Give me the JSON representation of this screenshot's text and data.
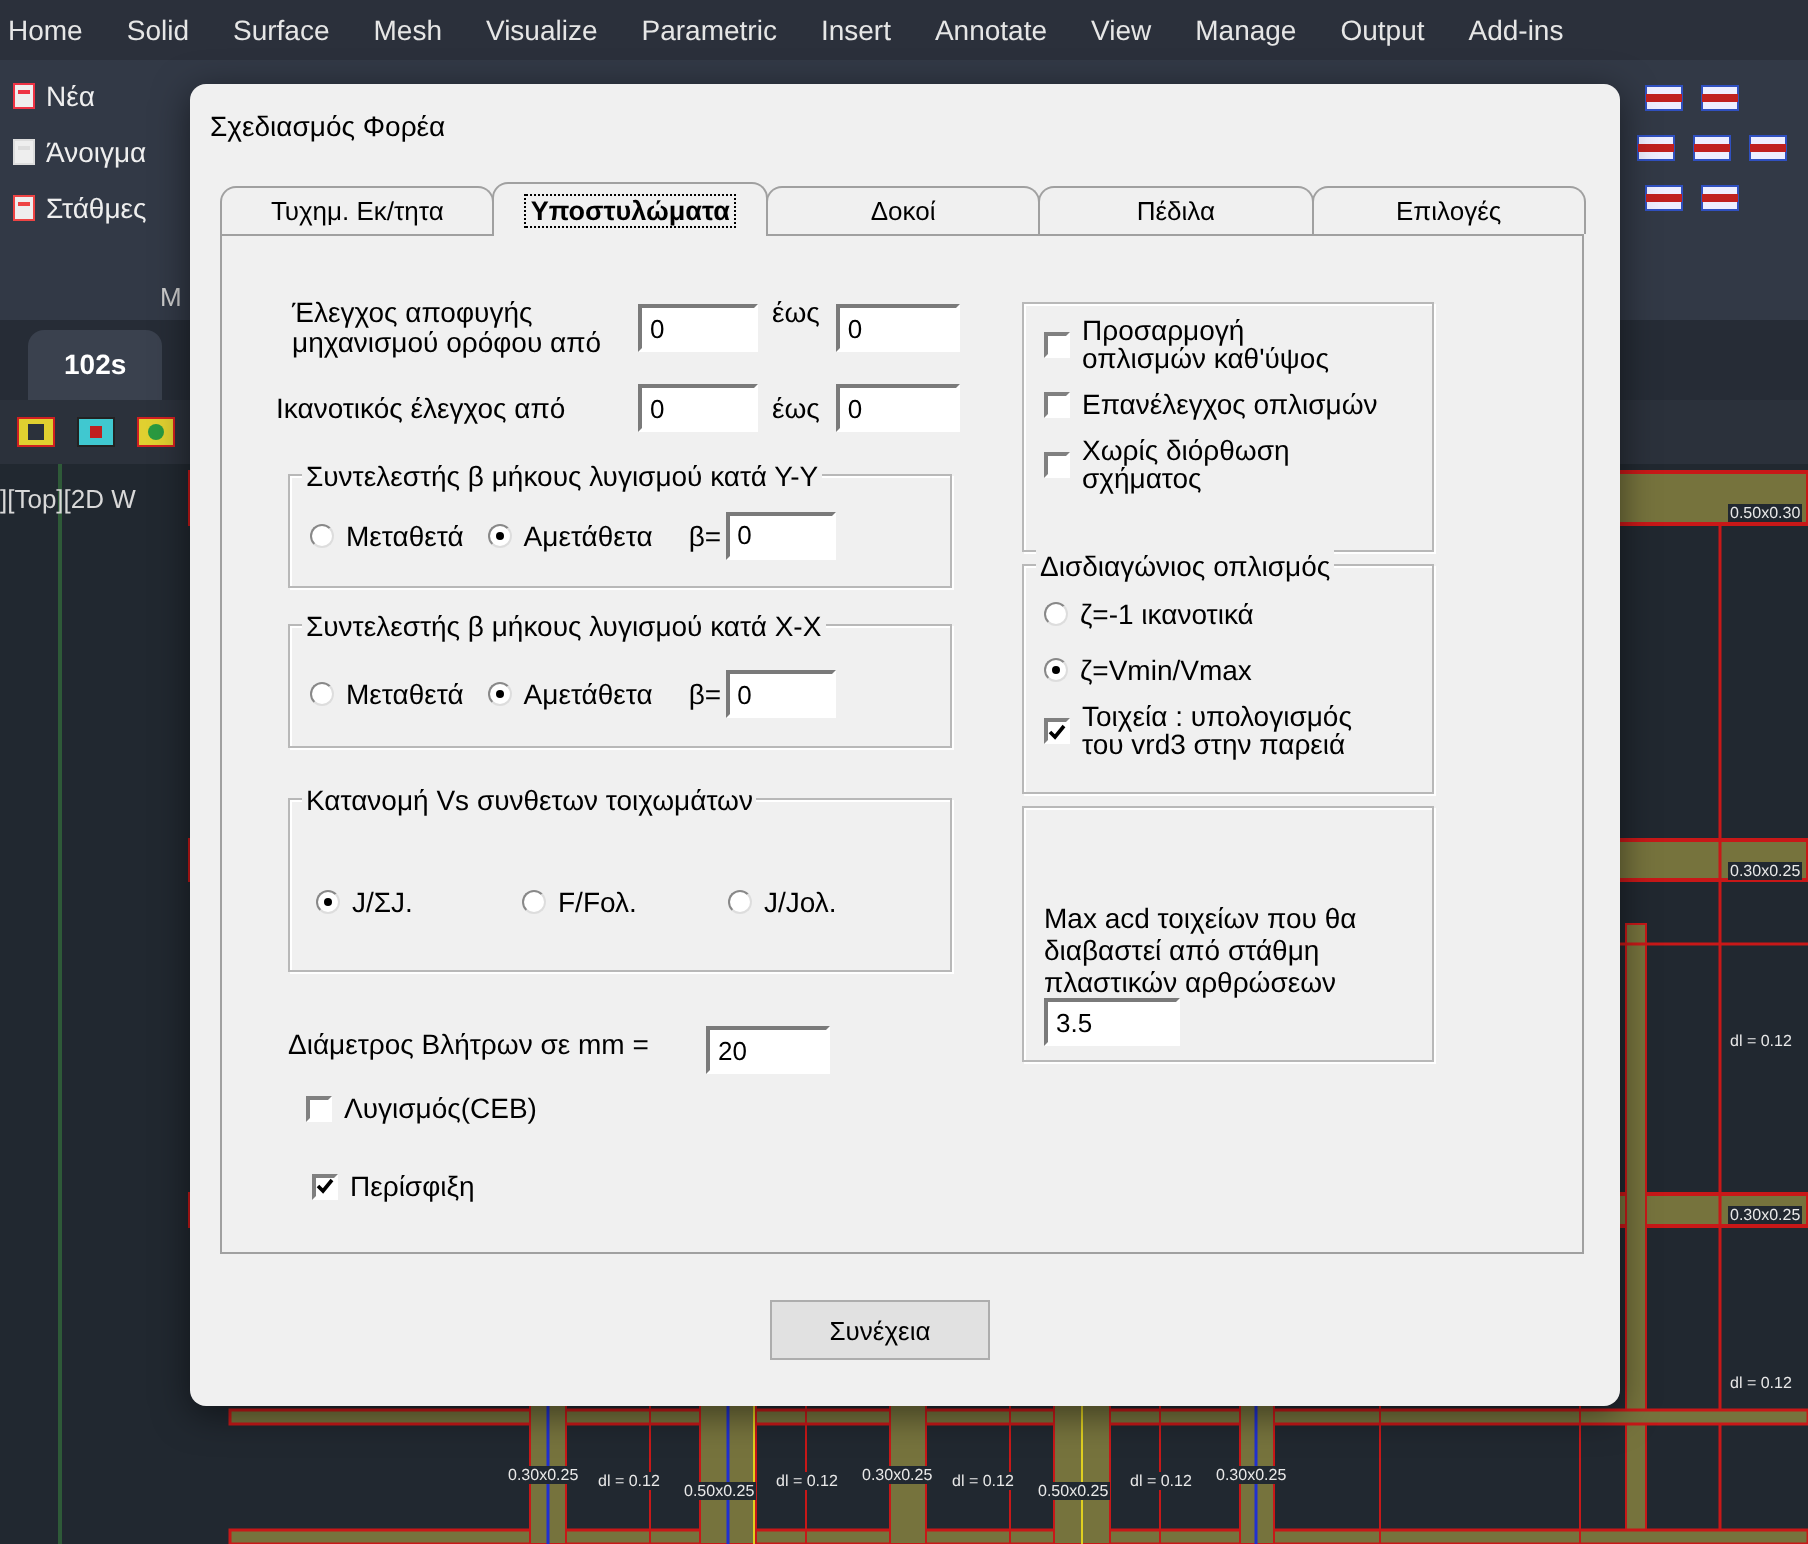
{
  "menu_bar": {
    "items": [
      "Home",
      "Solid",
      "Surface",
      "Mesh",
      "Visualize",
      "Parametric",
      "Insert",
      "Annotate",
      "View",
      "Manage",
      "Output",
      "Add-ins"
    ]
  },
  "ribbon": {
    "buttons": [
      {
        "label": "Νέα"
      },
      {
        "label": "Άνοιγμα"
      },
      {
        "label": "Στάθμες"
      }
    ],
    "panel_label": "M"
  },
  "file_tab": {
    "label": "102s"
  },
  "viewport": {
    "label": "][Top][2D W",
    "labels": [
      {
        "text": "0.50x0.30"
      },
      {
        "text": "0.30x0.25"
      },
      {
        "text": "dl = 0.12"
      },
      {
        "text": "0.30x0.25"
      },
      {
        "text": "dl = 0.12"
      },
      {
        "text": "0.30x0.25"
      },
      {
        "text": "dl = 0.12"
      },
      {
        "text": "0.50x0.25"
      },
      {
        "text": "dl = 0.12"
      },
      {
        "text": "0.30x0.25"
      },
      {
        "text": "dl = 0.12"
      },
      {
        "text": "0.50x0.25"
      },
      {
        "text": "dl = 0.12"
      },
      {
        "text": "0.30x0.25"
      }
    ]
  },
  "dialog": {
    "title": "Σχεδιασμός Φορέα",
    "tabs": [
      {
        "label": "Τυχημ. Εκ/τητα",
        "selected": false
      },
      {
        "label": "Υποστυλώματα",
        "selected": true
      },
      {
        "label": "Δοκοί",
        "selected": false
      },
      {
        "label": "Πέδιλα",
        "selected": false
      },
      {
        "label": "Επιλογές",
        "selected": false
      }
    ],
    "storey_check": {
      "label": "Έλεγχος αποφυγής μηχανισμού ορόφου από",
      "from": "0",
      "to_label": "έως",
      "to": "0"
    },
    "capacity_check": {
      "label": "Ικανοτικός έλεγχος από",
      "from": "0",
      "to_label": "έως",
      "to": "0"
    },
    "beta_groups": [
      {
        "title": "Συντελεστής β μήκους λυγισμού κατά Υ-Υ",
        "options": [
          {
            "label": "Μεταθετά",
            "selected": false
          },
          {
            "label": "Αμετάθετα",
            "selected": true
          }
        ],
        "beta_label": "β=",
        "beta": "0"
      },
      {
        "title": "Συντελεστής β μήκους λυγισμού κατά Χ-Χ",
        "options": [
          {
            "label": "Μεταθετά",
            "selected": false
          },
          {
            "label": "Αμετάθετα",
            "selected": true
          }
        ],
        "beta_label": "β=",
        "beta": "0"
      }
    ],
    "vs_distribution": {
      "title": "Κατανομή Vs συνθετων τοιχωμάτων",
      "options": [
        {
          "label": "J/ΣJ.",
          "selected": true
        },
        {
          "label": "F/Fολ.",
          "selected": false
        },
        {
          "label": "J/Jολ.",
          "selected": false
        }
      ]
    },
    "dowel_diameter": {
      "label": "Διάμετρος Βλήτρων σε mm =",
      "value": "20"
    },
    "options": [
      {
        "label": "Λυγισμός(CEB)",
        "checked": false
      },
      {
        "label": "Περίσφιξη",
        "checked": true
      }
    ],
    "reinforcement": [
      {
        "label": "Προσαρμογή οπλισμών καθ'ύψος",
        "checked": false
      },
      {
        "label": "Επανέλεγχος  οπλισμών",
        "checked": false
      },
      {
        "label": "Χωρίς διόρθωση σχήματος",
        "checked": false
      }
    ],
    "diagonal": {
      "title": "Δισδιαγώνιος οπλισμός",
      "options": [
        {
          "label": "ζ=-1 ικανοτικά",
          "selected": false
        },
        {
          "label": "ζ=Vmin/Vmax",
          "selected": true
        }
      ],
      "walls": {
        "label": "Τοιχεία : υπολογισμός του vrd3 στην παρειά",
        "checked": true
      }
    },
    "max_acd": {
      "label": "Max acd τοιχείων που θα διαβαστεί από στάθμη πλαστικών αρθρώσεων",
      "value": "3.5"
    },
    "continue_button": "Συνέχεια"
  }
}
